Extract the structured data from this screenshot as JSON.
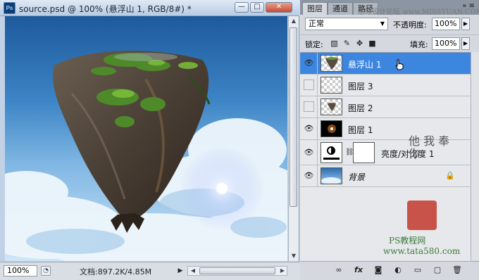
{
  "document": {
    "title": "source.psd @ 100% (悬浮山 1, RGB/8#) *",
    "app_icon": "Ps",
    "window_buttons": {
      "minimize": "—",
      "maximize": "□",
      "close": "✕"
    },
    "status": {
      "zoom": "100%",
      "doc_size": "文档:897.2K/4.85M"
    }
  },
  "panel": {
    "tabs": [
      "图层",
      "通道",
      "路径"
    ],
    "menu_glyph": "»  ≡",
    "blend_mode": "正常",
    "opacity_label": "不透明度:",
    "opacity_value": "100%",
    "lock_label": "锁定:",
    "fill_label": "填充:",
    "fill_value": "100%",
    "layers": [
      {
        "name": "悬浮山 1",
        "visible": true,
        "selected": true,
        "thumb": "rock"
      },
      {
        "name": "图层 3",
        "visible": false,
        "selected": false,
        "thumb": "transparent"
      },
      {
        "name": "图层 2",
        "visible": false,
        "selected": false,
        "thumb": "rock-small"
      },
      {
        "name": "图层 1",
        "visible": true,
        "selected": false,
        "thumb": "flare"
      },
      {
        "name": "亮度/对比度 1",
        "visible": true,
        "selected": false,
        "thumb": "adjustment"
      },
      {
        "name": "背景",
        "visible": true,
        "selected": false,
        "thumb": "sky",
        "locked": true
      }
    ],
    "bottom_icons": [
      "link-icon",
      "fx-icon",
      "mask-icon",
      "adjustment-icon",
      "group-icon",
      "new-layer-icon",
      "trash-icon"
    ]
  },
  "watermark": {
    "top": "思缘设计论坛 www.MISSYUAN.COM",
    "verse": "他 我 奉 你",
    "ps": "PS教程网",
    "url": "www.tata580.com"
  },
  "colors": {
    "selected": "#3d86e0",
    "sky": "#3a78b8"
  }
}
